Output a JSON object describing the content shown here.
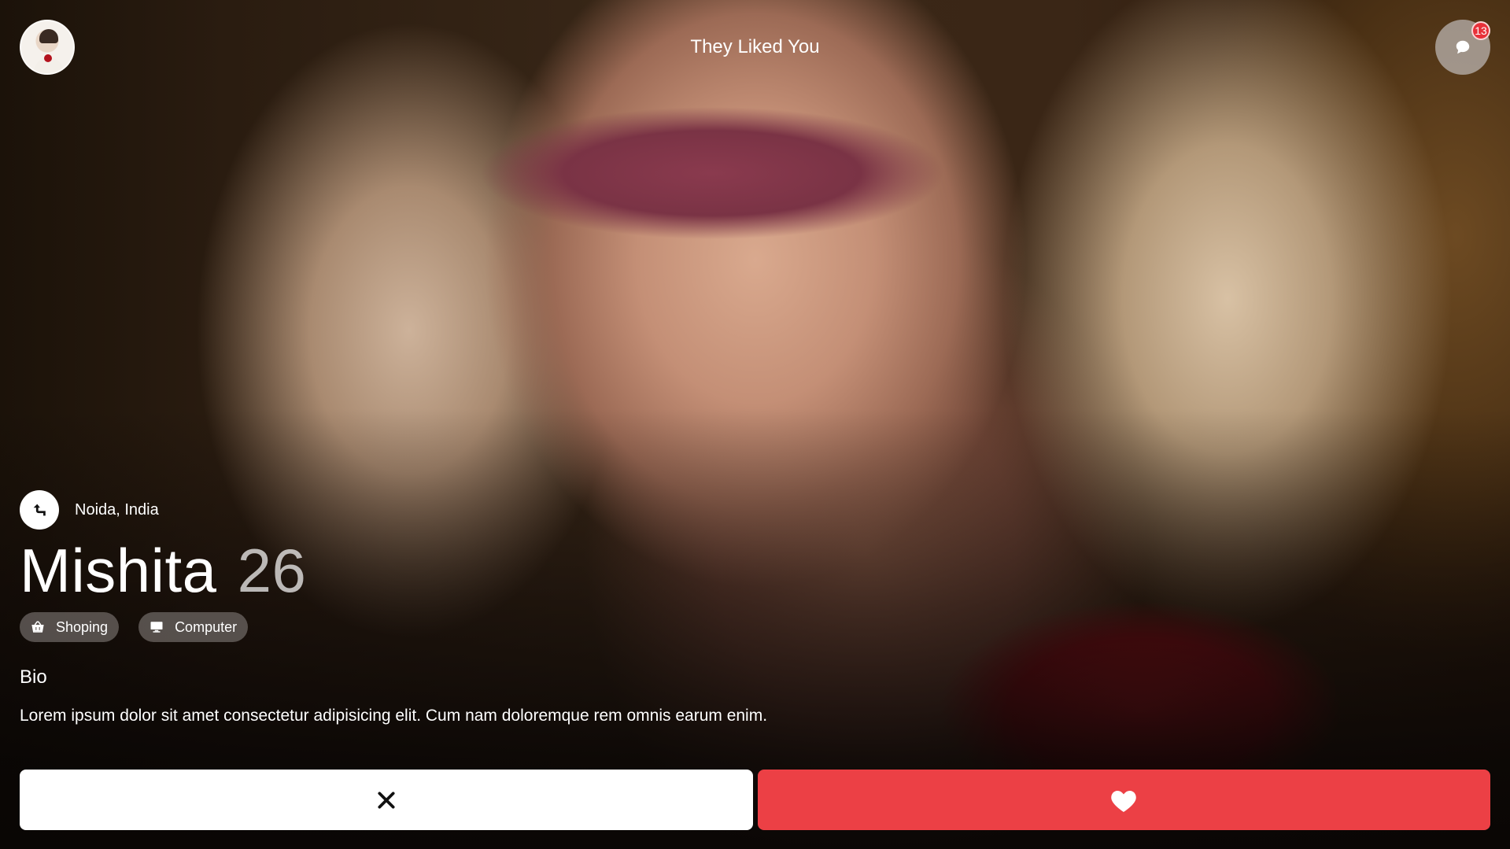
{
  "header": {
    "title": "They Liked You",
    "messages_badge_count": "13"
  },
  "profile": {
    "location": "Noida, India",
    "name": "Mishita",
    "age": "26",
    "interests": [
      {
        "label": "Shoping",
        "icon": "shopping-basket-icon"
      },
      {
        "label": "Computer",
        "icon": "computer-monitor-icon"
      }
    ],
    "bio_title": "Bio",
    "bio_text": "Lorem ipsum dolor sit amet consectetur adipisicing elit. Cum nam doloremque rem omnis earum enim."
  },
  "actions": {
    "reject_icon": "close-icon",
    "like_icon": "heart-icon"
  },
  "colors": {
    "like": "#ec4045",
    "reject": "#ffffff",
    "badge": "#e8313a"
  }
}
